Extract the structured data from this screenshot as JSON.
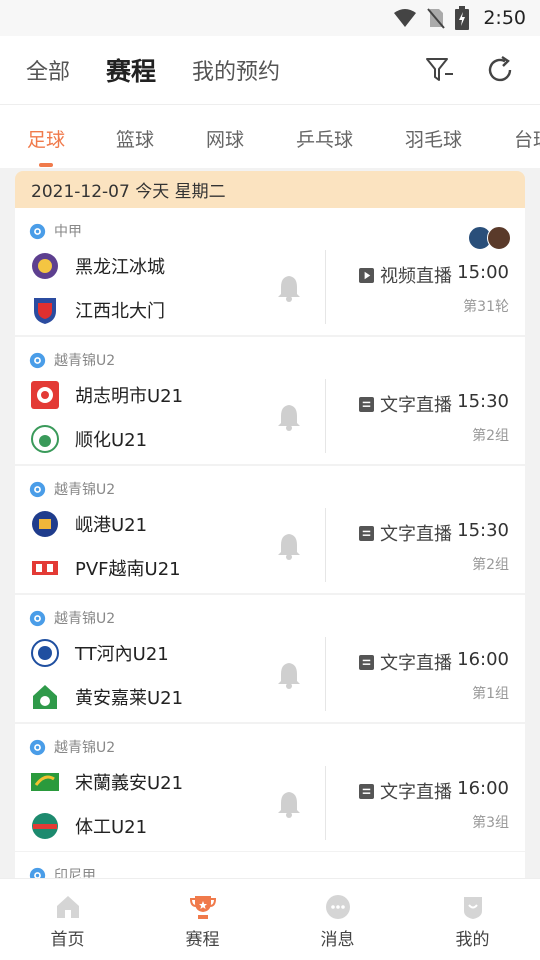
{
  "status_bar": {
    "time": "2:50"
  },
  "header": {
    "tabs": [
      {
        "label": "全部"
      },
      {
        "label": "赛程"
      },
      {
        "label": "我的预约"
      }
    ]
  },
  "sport_tabs": [
    "足球",
    "篮球",
    "网球",
    "乒乓球",
    "羽毛球",
    "台球"
  ],
  "date_bar": "2021-12-07  今天  星期二",
  "matches": [
    {
      "league": "中甲",
      "home": "黑龙江冰城",
      "away": "江西北大门",
      "live_type": "视频直播",
      "live_icon": "play-icon",
      "time": "15:00",
      "round": "第31轮",
      "avatars": true
    },
    {
      "league": "越青锦U2",
      "home": "胡志明市U21",
      "away": "顺化U21",
      "live_type": "文字直播",
      "live_icon": "text-live-icon",
      "time": "15:30",
      "round": "第2组",
      "avatars": false
    },
    {
      "league": "越青锦U2",
      "home": "岘港U21",
      "away": "PVF越南U21",
      "live_type": "文字直播",
      "live_icon": "text-live-icon",
      "time": "15:30",
      "round": "第2组",
      "avatars": false
    },
    {
      "league": "越青锦U2",
      "home": "TT河內U21",
      "away": "黄安嘉莱U21",
      "live_type": "文字直播",
      "live_icon": "text-live-icon",
      "time": "16:00",
      "round": "第1组",
      "avatars": false
    },
    {
      "league": "越青锦U2",
      "home": "宋蘭義安U21",
      "away": "体工U21",
      "live_type": "文字直播",
      "live_icon": "text-live-icon",
      "time": "16:00",
      "round": "第3组",
      "avatars": false
    }
  ],
  "partial_league": "印尼甲",
  "bottom_nav": [
    {
      "label": "首页",
      "icon": "home-icon"
    },
    {
      "label": "赛程",
      "icon": "trophy-icon"
    },
    {
      "label": "消息",
      "icon": "message-icon"
    },
    {
      "label": "我的",
      "icon": "profile-icon"
    }
  ],
  "colors": {
    "accent": "#f07a4b",
    "date_bar_bg": "#fbe3c0",
    "page_bg": "#f2f2f2"
  }
}
